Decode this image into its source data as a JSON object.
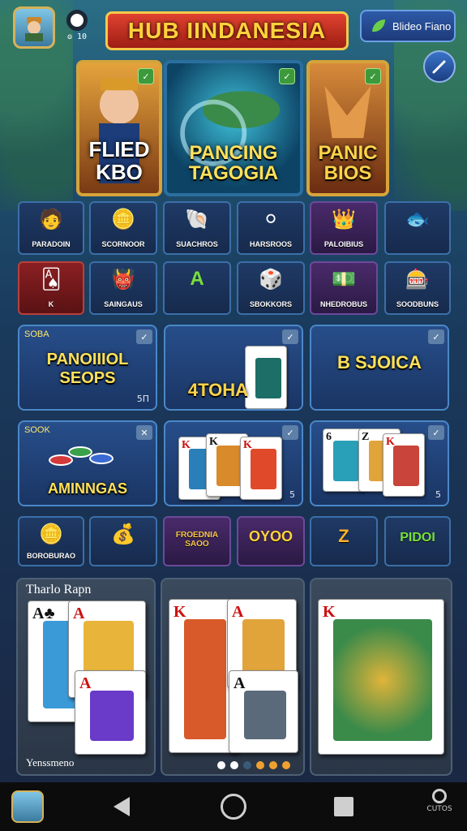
{
  "header": {
    "title": "HUB IINDANESIA",
    "coin_count": "ʘ 10",
    "video_button_label": "Blideo Fiano"
  },
  "featured": [
    {
      "label": "FLIED KBO"
    },
    {
      "label": "PANCING TAGOGIA"
    },
    {
      "label": "PANIC BIOS"
    }
  ],
  "row1": [
    {
      "label": "PARADOIN",
      "icon": "person-icon"
    },
    {
      "label": "SCORNOOR",
      "icon": "chips-icon"
    },
    {
      "label": "SUACHROS",
      "icon": "shell-icon"
    },
    {
      "label": "HARSROOS",
      "icon": "plate-icon"
    },
    {
      "label": "PALOIBIUS",
      "icon": "crown-icon"
    },
    {
      "label": "",
      "icon": "fish-icon"
    }
  ],
  "row2": [
    {
      "label": "K",
      "icon": "card-icon"
    },
    {
      "label": "SAINGAUS",
      "icon": "monster-icon"
    },
    {
      "label": "A",
      "icon": "letter-a-icon"
    },
    {
      "label": "SBOKKORS",
      "icon": "dice-icon"
    },
    {
      "label": "NHEDROBUS",
      "icon": "bills-icon"
    },
    {
      "label": "SOODBUNS",
      "icon": "machine-icon"
    }
  ],
  "mcards_row1": [
    {
      "corner": "SOBA",
      "title": "PANOIIIOL SEOPS",
      "foot": "5Π"
    },
    {
      "corner": "",
      "title": "4TOHA",
      "foot": ""
    },
    {
      "corner": "",
      "title": "B SJOICA",
      "foot": ""
    }
  ],
  "mcards_row2": [
    {
      "corner": "SOOK",
      "title": "AMINNGAS",
      "foot": ""
    },
    {
      "corner": "",
      "title": "",
      "foot": "5"
    },
    {
      "corner": "",
      "title": "",
      "foot": "5"
    }
  ],
  "row3": [
    {
      "label": "BOROBURAO",
      "icon": "gold-icon"
    },
    {
      "label": "",
      "icon": "treasure-icon"
    },
    {
      "label": "FROEDNIA SAOO",
      "icon": "text-icon"
    },
    {
      "label": "OYOO",
      "icon": "oyoo-icon"
    },
    {
      "label": "Z",
      "icon": "z-icon"
    },
    {
      "label": "PIDOI",
      "icon": "pidoi-icon"
    }
  ],
  "panels": [
    {
      "title": "Tharlo Rapn",
      "footer": "Yenssmeno"
    },
    {
      "title": "",
      "footer": ""
    },
    {
      "title": "",
      "footer": ""
    }
  ],
  "navbar": {
    "search_label": "CUTOS"
  },
  "colors": {
    "accent_gold": "#d6a43a",
    "title_red": "#e0422f",
    "tile_blue": "#1f3a66"
  }
}
